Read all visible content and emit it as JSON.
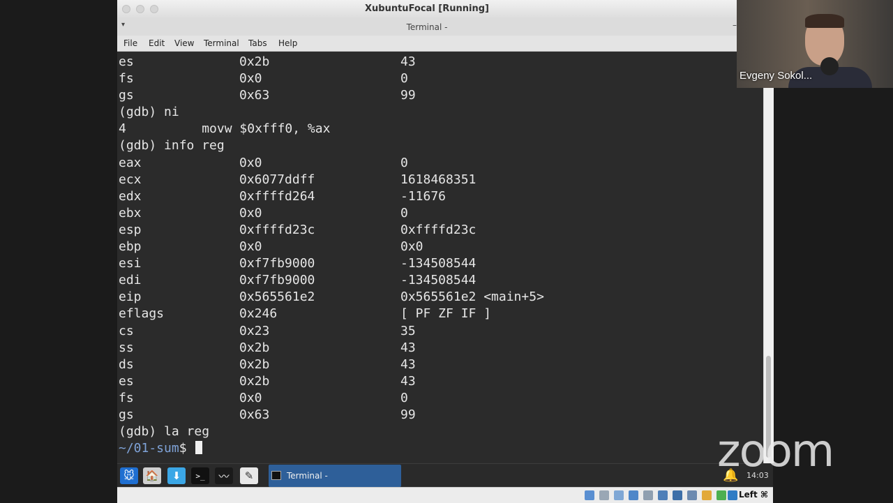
{
  "vbox": {
    "title": "XubuntuFocal [Running]",
    "host_key": "Left ⌘"
  },
  "terminal": {
    "title": "Terminal -",
    "menu": [
      "File",
      "Edit",
      "View",
      "Terminal",
      "Tabs",
      "Help"
    ],
    "lines": [
      [
        "es",
        "0x2b",
        "43"
      ],
      [
        "fs",
        "0x0",
        "0"
      ],
      [
        "gs",
        "0x63",
        "99"
      ],
      "(gdb) ni",
      "4          movw $0xfff0, %ax",
      "(gdb) info reg",
      [
        "eax",
        "0x0",
        "0"
      ],
      [
        "ecx",
        "0x6077ddff",
        "1618468351"
      ],
      [
        "edx",
        "0xffffd264",
        "-11676"
      ],
      [
        "ebx",
        "0x0",
        "0"
      ],
      [
        "esp",
        "0xffffd23c",
        "0xffffd23c"
      ],
      [
        "ebp",
        "0x0",
        "0x0"
      ],
      [
        "esi",
        "0xf7fb9000",
        "-134508544"
      ],
      [
        "edi",
        "0xf7fb9000",
        "-134508544"
      ],
      [
        "eip",
        "0x565561e2",
        "0x565561e2 <main+5>"
      ],
      [
        "eflags",
        "0x246",
        "[ PF ZF IF ]"
      ],
      [
        "cs",
        "0x23",
        "35"
      ],
      [
        "ss",
        "0x2b",
        "43"
      ],
      [
        "ds",
        "0x2b",
        "43"
      ],
      [
        "es",
        "0x2b",
        "43"
      ],
      [
        "fs",
        "0x0",
        "0"
      ],
      [
        "gs",
        "0x63",
        "99"
      ],
      "(gdb) la reg"
    ],
    "prompt_path": "~/01-sum",
    "prompt_symbol": "$ "
  },
  "panel": {
    "launchers": [
      {
        "name": "xfce-menu-icon",
        "glyph": "🐭",
        "bg": "#1f6fd1"
      },
      {
        "name": "file-manager-icon",
        "glyph": "🏠",
        "bg": "#d0d0d0"
      },
      {
        "name": "downloads-icon",
        "glyph": "⬇",
        "bg": "#3ba7e6"
      },
      {
        "name": "terminal-icon",
        "glyph": ">_",
        "bg": "#111111"
      },
      {
        "name": "task-manager-icon",
        "glyph": "〰",
        "bg": "#1a1a1a"
      },
      {
        "name": "text-editor-icon",
        "glyph": "✎",
        "bg": "#e8e8e8"
      }
    ],
    "taskbar_label": "Terminal -",
    "clock": "14:03"
  },
  "zoom": {
    "participant_name": "Evgeny Sokol...",
    "watermark": "zoom"
  }
}
